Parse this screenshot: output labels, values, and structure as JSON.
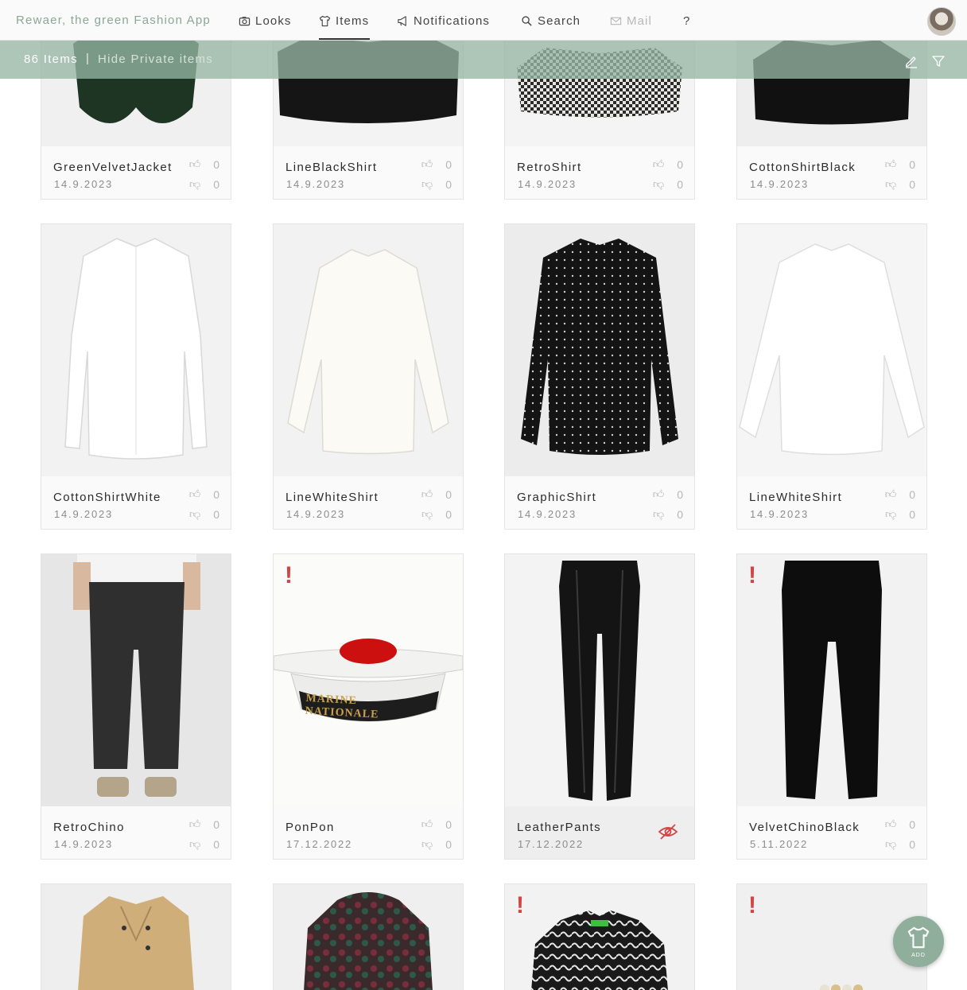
{
  "header": {
    "brand": "Rewaer, the green Fashion App",
    "nav": [
      {
        "label": "Looks",
        "icon": "camera-icon"
      },
      {
        "label": "Items",
        "icon": "shirt-icon"
      },
      {
        "label": "Notifications",
        "icon": "megaphone-icon"
      },
      {
        "label": "Search",
        "icon": "search-icon"
      },
      {
        "label": "Mail",
        "icon": "mail-icon"
      },
      {
        "label": "?",
        "icon": "help-icon"
      }
    ],
    "active_tab": "Items"
  },
  "subbar": {
    "count": "86 Items",
    "separator": "|",
    "hide_private": "Hide Private items",
    "edit_icon": "edit-pencil-icon",
    "filter_icon": "filter-icon"
  },
  "items": [
    {
      "name": "GreenVelvetJacket",
      "date": "14.9.2023",
      "likes": "0",
      "dislikes": "0"
    },
    {
      "name": "LineBlackShirt",
      "date": "14.9.2023",
      "likes": "0",
      "dislikes": "0"
    },
    {
      "name": "RetroShirt",
      "date": "14.9.2023",
      "likes": "0",
      "dislikes": "0"
    },
    {
      "name": "CottonShirtBlack",
      "date": "14.9.2023",
      "likes": "0",
      "dislikes": "0"
    },
    {
      "name": "CottonShirtWhite",
      "date": "14.9.2023",
      "likes": "0",
      "dislikes": "0"
    },
    {
      "name": "LineWhiteShirt",
      "date": "14.9.2023",
      "likes": "0",
      "dislikes": "0"
    },
    {
      "name": "GraphicShirt",
      "date": "14.9.2023",
      "likes": "0",
      "dislikes": "0"
    },
    {
      "name": "LineWhiteShirt",
      "date": "14.9.2023",
      "likes": "0",
      "dislikes": "0"
    },
    {
      "name": "RetroChino",
      "date": "14.9.2023",
      "likes": "0",
      "dislikes": "0"
    },
    {
      "name": "PonPon",
      "date": "17.12.2022",
      "likes": "0",
      "dislikes": "0",
      "alert": "!"
    },
    {
      "name": "LeatherPants",
      "date": "17.12.2022",
      "private": true,
      "status_icon": "eye-slash-icon"
    },
    {
      "name": "VelvetChinoBlack",
      "date": "5.11.2022",
      "likes": "0",
      "dislikes": "0",
      "alert": "!"
    },
    {
      "name": "",
      "date": ""
    },
    {
      "name": "",
      "date": ""
    },
    {
      "name": "",
      "date": "",
      "alert": "!"
    },
    {
      "name": "",
      "date": "",
      "alert": "!"
    }
  ],
  "hat_text": "MARINE NATIONALE",
  "fab": {
    "label": "ADD",
    "icon": "shirt-add-icon"
  },
  "colors": {
    "accent": "#8fae9c",
    "alert": "#d04545",
    "subbar": "#96b6a3"
  }
}
